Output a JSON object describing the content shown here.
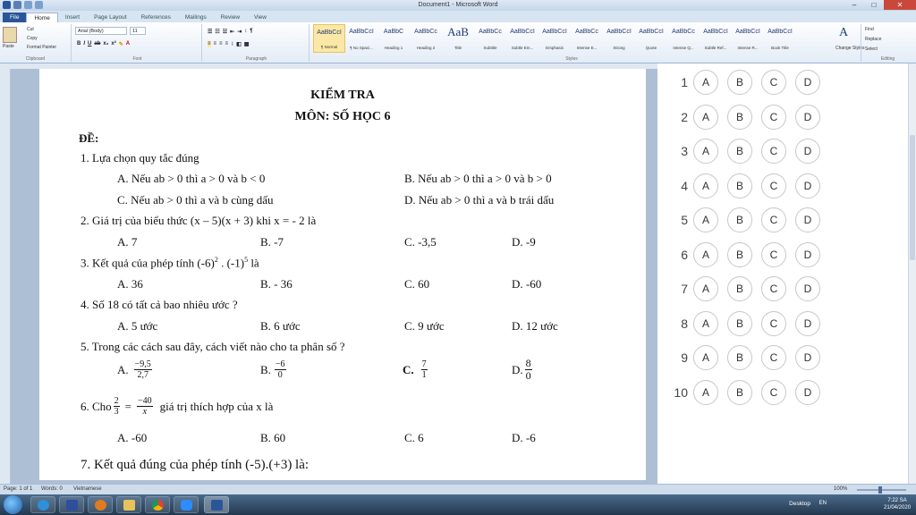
{
  "window": {
    "title": "Document1 - Microsoft Word",
    "minimize": "–",
    "maximize": "□",
    "close": "✕"
  },
  "ribbon_tabs": [
    "File",
    "Home",
    "Insert",
    "Page Layout",
    "References",
    "Mailings",
    "Review",
    "View"
  ],
  "ribbon": {
    "clipboard": {
      "paste": "Paste",
      "cut": "Cut",
      "copy": "Copy",
      "format_painter": "Format Painter",
      "label": "Clipboard"
    },
    "font": {
      "name": "Arial (Body)",
      "size": "11",
      "label": "Font"
    },
    "paragraph": {
      "label": "Paragraph"
    },
    "styles": {
      "label": "Styles",
      "items": [
        {
          "sample": "AaBbCcI",
          "name": "¶ Normal"
        },
        {
          "sample": "AaBbCcI",
          "name": "¶ No Spaci..."
        },
        {
          "sample": "AaBbC",
          "name": "Heading 1"
        },
        {
          "sample": "AaBbCc",
          "name": "Heading 2"
        },
        {
          "sample": "AaB",
          "name": "Title"
        },
        {
          "sample": "AaBbCc",
          "name": "Subtitle"
        },
        {
          "sample": "AaBbCcI",
          "name": "Subtle Em..."
        },
        {
          "sample": "AaBbCcI",
          "name": "Emphasis"
        },
        {
          "sample": "AaBbCc",
          "name": "Intense E..."
        },
        {
          "sample": "AaBbCcI",
          "name": "Strong"
        },
        {
          "sample": "AaBbCcI",
          "name": "Quote"
        },
        {
          "sample": "AaBbCc",
          "name": "Intense Q..."
        },
        {
          "sample": "AaBbCcI",
          "name": "Subtle Ref..."
        },
        {
          "sample": "AaBbCcI",
          "name": "Intense R..."
        },
        {
          "sample": "AaBbCcI",
          "name": "Book Title"
        }
      ],
      "change_styles": "Change Styles"
    },
    "editing": {
      "find": "Find",
      "replace": "Replace",
      "select": "Select",
      "label": "Editing"
    }
  },
  "document": {
    "title": "KIỂM TRA",
    "subject": "MÔN: SỐ HỌC 6",
    "de_label": "ĐỀ:",
    "q1": {
      "text": "1.  Lựa chọn quy tắc đúng",
      "a": "A. Nếu ab > 0 thì a > 0 và b < 0",
      "b": "B. Nếu ab > 0 thì a > 0 và b > 0",
      "c": "C. Nếu ab > 0 thì  a và b cùng dấu",
      "d": "D. Nếu ab > 0 thì a và b trái dấu"
    },
    "q2": {
      "text": "2. Giá trị của biểu thức (x – 5)(x + 3) khi x = - 2 là",
      "a": "A. 7",
      "b": "B. -7",
      "c": "C. -3,5",
      "d": "D. -9"
    },
    "q3": {
      "text_pre": "3. Kết quả của phép tính (-6)",
      "exp1": "2",
      "text_mid": " . (-1)",
      "exp2": "5",
      "text_post": "  là",
      "a": "A. 36",
      "b": "B. - 36",
      "c": "C. 60",
      "d": "D. -60"
    },
    "q4": {
      "text": "4. Số 18 có tất cả bao nhiêu ước ?",
      "a": "A. 5 ước",
      "b": "B. 6 ước",
      "c": "C. 9 ước",
      "d": "D. 12 ước"
    },
    "q5": {
      "text": "5. Trong các cách sau đây, cách viết nào cho ta phân số ?",
      "a_label": "A.",
      "a_num": "−9,5",
      "a_den": "2,7",
      "b_label": "B.",
      "b_num": "−6",
      "b_den": "0",
      "c_label": "C.",
      "c_num": "7",
      "c_den": "1",
      "d_label": "D.",
      "d_num": "8",
      "d_den": "0"
    },
    "q6": {
      "pre": "6. Cho",
      "f1_num": "2",
      "f1_den": "3",
      "eq": "=",
      "f2_num": "−40",
      "f2_den": "x",
      "post": "giá trị thích hợp của x là",
      "a": "A. -60",
      "b": "B. 60",
      "c": "C. 6",
      "d": "D. -6"
    },
    "q7": {
      "text": "7. Kết quả đúng của phép tính (-5).(+3) là:"
    }
  },
  "answer_sheet": {
    "options": [
      "A",
      "B",
      "C",
      "D"
    ],
    "questions": [
      "1",
      "2",
      "3",
      "4",
      "5",
      "6",
      "7",
      "8",
      "9",
      "10"
    ]
  },
  "statusbar": {
    "page": "Page: 1 of 1",
    "words": "Words: 0",
    "language": "Vietnamese",
    "zoom": "100%"
  },
  "taskbar": {
    "desktop": "Desktop",
    "lang": "EN",
    "time": "7:22 SA",
    "date": "21/04/2020"
  }
}
